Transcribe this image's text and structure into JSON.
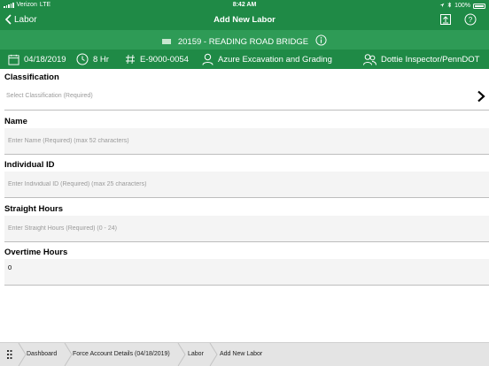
{
  "status_bar": {
    "carrier": "Verizon",
    "network": "LTE",
    "time": "8:42 AM",
    "battery": "100%"
  },
  "nav": {
    "back_label": "Labor",
    "title": "Add New Labor",
    "icons": [
      "upload-icon",
      "help-icon"
    ]
  },
  "project": {
    "name": "20159 - READING ROAD BRIDGE"
  },
  "info": {
    "date": "04/18/2019",
    "hours": "8 Hr",
    "number": "E-9000-0054",
    "contractor": "Azure Excavation and Grading",
    "inspector": "Dottie Inspector/PennDOT"
  },
  "form": {
    "classification": {
      "label": "Classification",
      "placeholder": "Select Classification (Required)"
    },
    "name": {
      "label": "Name",
      "placeholder": "Enter Name (Required) (max 52 characters)",
      "value": ""
    },
    "individual_id": {
      "label": "Individual ID",
      "placeholder": "Enter Individual ID (Required) (max 25 characters)",
      "value": ""
    },
    "straight_hours": {
      "label": "Straight Hours",
      "placeholder": "Enter Straight Hours (Required) (0 - 24)",
      "value": ""
    },
    "overtime_hours": {
      "label": "Overtime Hours",
      "value": "0"
    }
  },
  "breadcrumb": [
    "Dashboard",
    "Force Account Details (04/18/2019)",
    "Labor",
    "Add New Labor"
  ],
  "colors": {
    "nav_green": "#1f8a46",
    "project_green": "#2e9b56",
    "field_bg": "#f4f4f4",
    "breadcrumb_bg": "#e4e4e4"
  }
}
